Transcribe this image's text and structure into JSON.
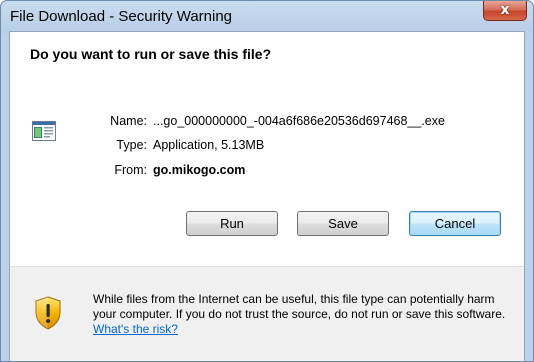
{
  "window": {
    "title": "File Download - Security Warning",
    "close_glyph": "x"
  },
  "dialog": {
    "heading": "Do you want to run or save this file?",
    "file_icon": "application-icon",
    "fields": {
      "name_label": "Name:",
      "name_value": "...go_000000000_-004a6f686e20536d697468__.exe",
      "type_label": "Type:",
      "type_value": "Application, 5.13MB",
      "from_label": "From:",
      "from_value": "go.mikogo.com"
    },
    "buttons": {
      "run": "Run",
      "save": "Save",
      "cancel": "Cancel"
    }
  },
  "warning": {
    "icon": "shield-warning-icon",
    "text": "While files from the Internet can be useful, this file type can potentially harm your computer. If you do not trust the source, do not run or save this software. ",
    "link": "What's the risk?"
  },
  "colors": {
    "link": "#0066cc",
    "titlebar": "#c9dbee",
    "close_button": "#c5452a"
  }
}
